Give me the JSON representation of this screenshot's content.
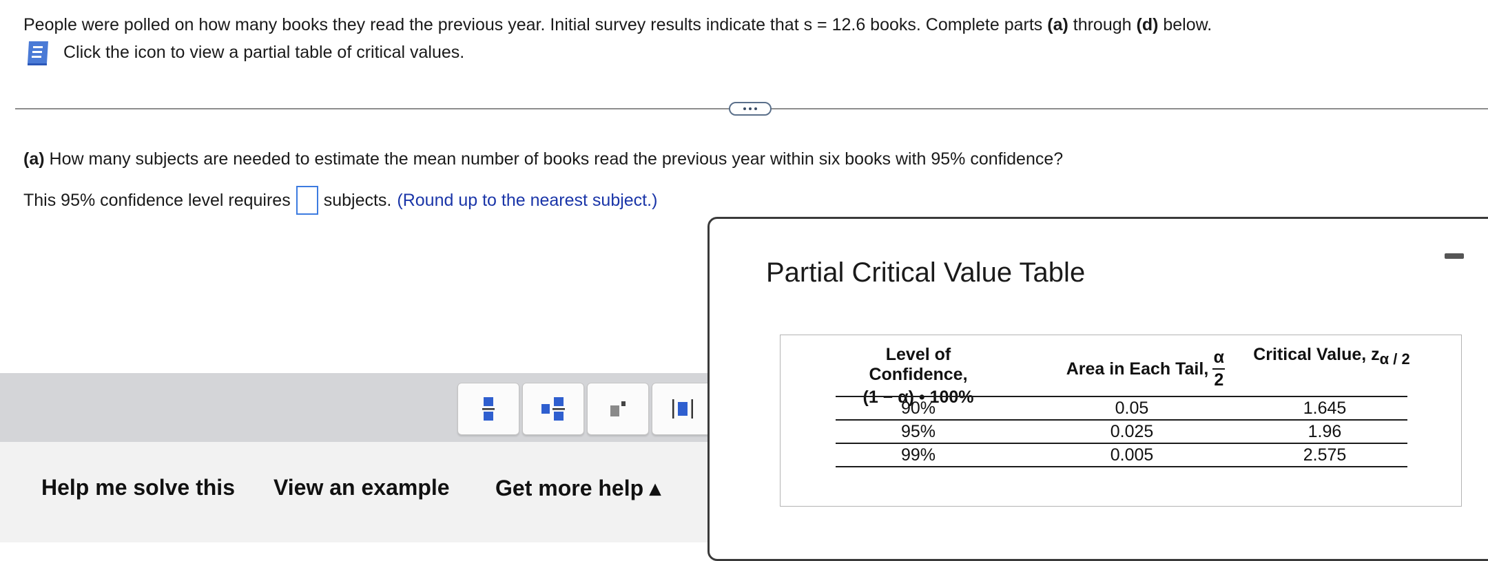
{
  "intro": {
    "part1": "People were polled on how many books they read the previous year. Initial survey results indicate that s = 12.6 books. Complete parts ",
    "part_a": "(a)",
    "part_through": " through ",
    "part_d": "(d)",
    "part_end": " below.",
    "icon_prompt": "Click the icon to view a partial table of critical values."
  },
  "question": {
    "label": "(a)",
    "text": " How many subjects are needed to estimate the mean number of books read the previous year within six books with 95% confidence?"
  },
  "answer": {
    "prefix": "This 95% confidence level requires",
    "value": "",
    "suffix": "subjects.",
    "hint": "(Round up to the nearest subject.)"
  },
  "help": {
    "solve": "Help me solve this",
    "example": "View an example",
    "more": "Get more help ▴"
  },
  "panel": {
    "title": "Partial Critical Value Table",
    "headers": {
      "confidence_line1": "Level of Confidence,",
      "confidence_line2": "(1 − α) • 100%",
      "area": "Area in Each Tail,",
      "alpha": "α",
      "two": "2",
      "critical": "Critical Value, z",
      "critical_sub": "α / 2"
    },
    "rows": [
      {
        "confidence": "90%",
        "area": "0.05",
        "critical": "1.645"
      },
      {
        "confidence": "95%",
        "area": "0.025",
        "critical": "1.96"
      },
      {
        "confidence": "99%",
        "area": "0.005",
        "critical": "2.575"
      }
    ]
  },
  "colors": {
    "accent": "#3c7be0",
    "hint": "#1a35a8",
    "icon_blue": "#4a7ad6"
  }
}
